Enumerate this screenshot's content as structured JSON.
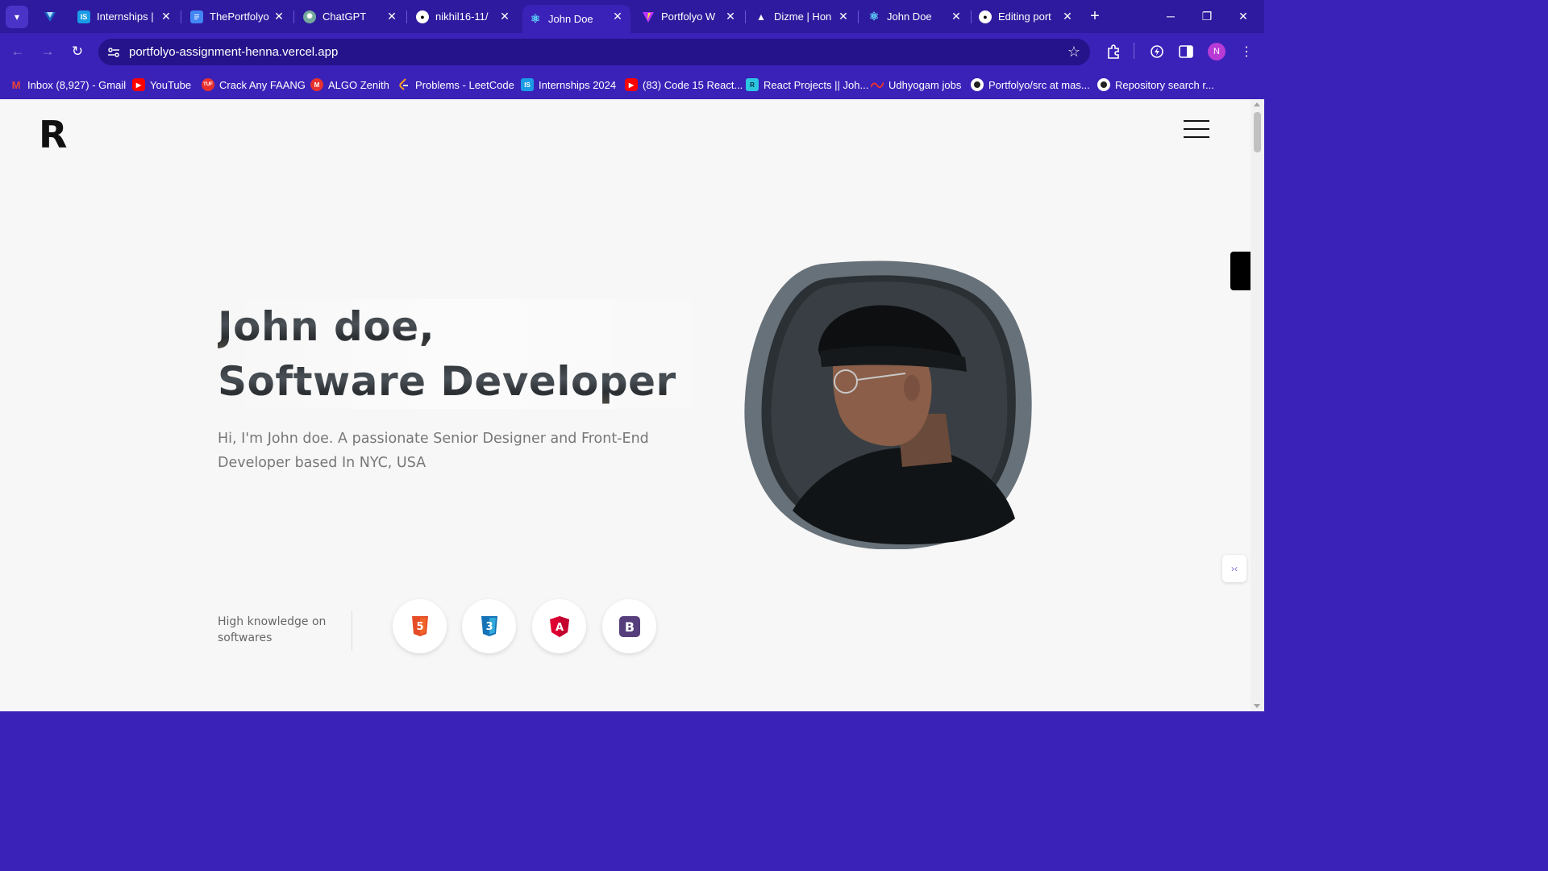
{
  "browser": {
    "tabs": [
      {
        "label": "Internships |",
        "fav": "IS",
        "fav_color": "#1a9be6"
      },
      {
        "label": "ThePortfolyo",
        "fav": "",
        "fav_color": "#4285f4"
      },
      {
        "label": "ChatGPT",
        "fav": "",
        "fav_color": "#74aa9c"
      },
      {
        "label": "nikhil16-11/",
        "fav": "",
        "fav_color": "#ffffff"
      },
      {
        "label": "John Doe",
        "fav": "",
        "fav_color": "#61dafb"
      },
      {
        "label": "Portfolyo W",
        "fav": "",
        "fav_color": "#f7b500"
      },
      {
        "label": "Dizme | Hon",
        "fav": "",
        "fav_color": "#ffffff"
      },
      {
        "label": "John Doe",
        "fav": "",
        "fav_color": "#61dafb"
      },
      {
        "label": "Editing port",
        "fav": "",
        "fav_color": "#ffffff"
      }
    ],
    "url": "portfolyo-assignment-henna.vercel.app",
    "profile_initial": "N",
    "bookmarks": [
      {
        "label": "Inbox (8,927) - Gmail",
        "fav": "M",
        "color": "#ea4335"
      },
      {
        "label": "YouTube",
        "fav": "▶",
        "color": "#ff0000"
      },
      {
        "label": "Crack Any FAANG",
        "fav": "TUF",
        "color": "#e8312f"
      },
      {
        "label": "ALGO Zenith",
        "fav": "M",
        "color": "#e8312f"
      },
      {
        "label": "Problems - LeetCode",
        "fav": "",
        "color": "#f89f1b"
      },
      {
        "label": "Internships 2024",
        "fav": "IS",
        "color": "#1a9be6"
      },
      {
        "label": "(83) Code 15 React...",
        "fav": "▶",
        "color": "#ff0000"
      },
      {
        "label": "React Projects || Joh...",
        "fav": "R",
        "color": "#2bc6e0"
      },
      {
        "label": "Udhyogam jobs",
        "fav": "",
        "color": "#e8312f"
      },
      {
        "label": "Portfolyo/src at mas...",
        "fav": "",
        "color": "#ffffff"
      },
      {
        "label": "Repository search r...",
        "fav": "",
        "color": "#ffffff"
      }
    ]
  },
  "site": {
    "logo": "R",
    "hero": {
      "line1": "John doe,",
      "line2": "Software Developer",
      "subtitle": "Hi, I'm John doe. A passionate Senior Designer and Front-End Developer based In NYC, USA"
    },
    "skills": {
      "label": "High knowledge on softwares",
      "items": [
        {
          "name": "html5-icon",
          "letter": "5",
          "color": "#e44d26"
        },
        {
          "name": "css3-icon",
          "letter": "3",
          "color": "#1572b6"
        },
        {
          "name": "angular-icon",
          "letter": "A",
          "color": "#dd0031"
        },
        {
          "name": "bootstrap-icon",
          "letter": "B",
          "color": "#563d7c"
        }
      ]
    }
  }
}
